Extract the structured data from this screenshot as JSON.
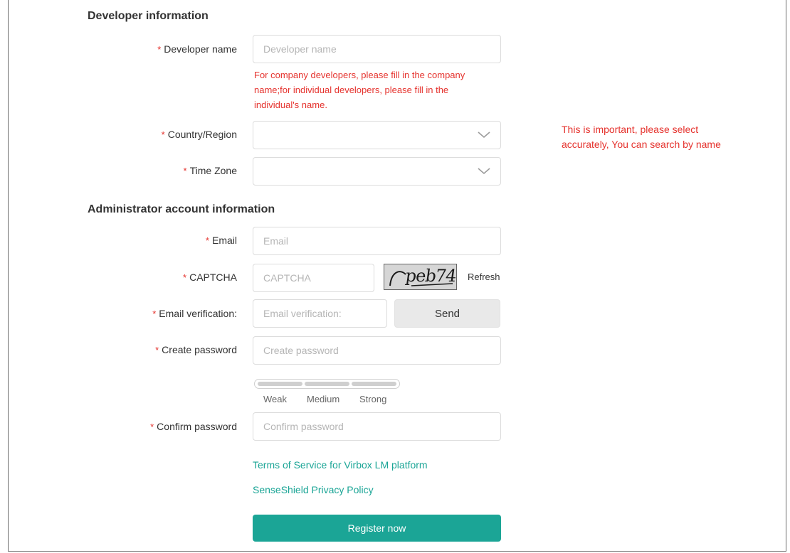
{
  "developer_section": {
    "title": "Developer information",
    "developer_name": {
      "required_mark": "*",
      "label": "Developer name",
      "placeholder": "Developer name",
      "value": "",
      "hint_line1": "For company developers, please fill in the company",
      "hint_line2": "name;for individual developers, please fill in the",
      "hint_line3": "individual's name."
    },
    "country": {
      "required_mark": "*",
      "label": "Country/Region",
      "selected": "",
      "icon": "chevron-down-icon",
      "note_line1": "This is important, please select",
      "note_line2": "accurately, You can search by name"
    },
    "time_zone": {
      "required_mark": "*",
      "label": "Time Zone",
      "selected": "",
      "icon": "chevron-down-icon"
    }
  },
  "admin_section": {
    "title": "Administrator account information",
    "email": {
      "required_mark": "*",
      "label": "Email",
      "placeholder": "Email",
      "value": ""
    },
    "captcha": {
      "required_mark": "*",
      "label": "CAPTCHA",
      "placeholder": "CAPTCHA",
      "value": "",
      "image_text": "peb74",
      "refresh_label": "Refresh"
    },
    "email_verification": {
      "required_mark": "*",
      "label": "Email verification:",
      "placeholder": "Email verification:",
      "value": "",
      "send_label": "Send"
    },
    "create_password": {
      "required_mark": "*",
      "label": "Create password",
      "placeholder": "Create password",
      "value": "",
      "strength_levels": [
        "Weak",
        "Medium",
        "Strong"
      ],
      "strength_filled": 0
    },
    "confirm_password": {
      "required_mark": "*",
      "label": "Confirm password",
      "placeholder": "Confirm password",
      "value": ""
    }
  },
  "links": {
    "terms": "Terms of Service for Virbox LM platform",
    "privacy": "SenseShield Privacy Policy"
  },
  "register_label": "Register now",
  "colors": {
    "accent": "#1ba596",
    "error": "#e5322d"
  }
}
